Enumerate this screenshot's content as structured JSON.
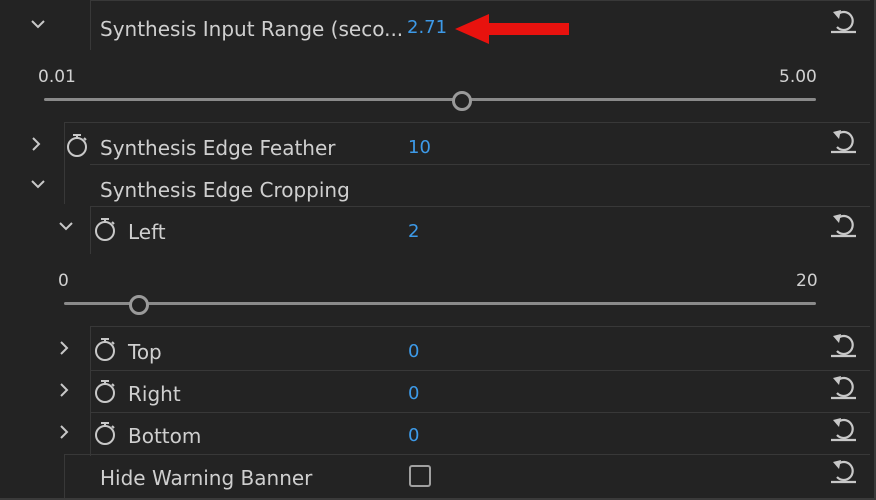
{
  "rows": {
    "input_range": {
      "label": "Synthesis Input Range (seco...",
      "value": "2.71",
      "min_label": "0.01",
      "max_label": "5.00",
      "slider_fraction": 0.541
    },
    "edge_feather": {
      "label": "Synthesis Edge Feather",
      "value": "10"
    },
    "edge_cropping": {
      "label": "Synthesis Edge Cropping"
    },
    "left": {
      "label": "Left",
      "value": "2",
      "min_label": "0",
      "max_label": "20",
      "slider_fraction": 0.1
    },
    "top": {
      "label": "Top",
      "value": "0"
    },
    "right": {
      "label": "Right",
      "value": "0"
    },
    "bottom": {
      "label": "Bottom",
      "value": "0"
    },
    "hide_warning": {
      "label": "Hide Warning Banner",
      "checked": false
    }
  },
  "icons": {
    "expand": "chevron-down-icon",
    "collapse": "chevron-right-icon",
    "stopwatch": "stopwatch-icon",
    "reset": "reset-icon",
    "annotation": "red-arrow-icon"
  },
  "colors": {
    "background": "#232323",
    "value_blue": "#3d9ae8",
    "arrow_red": "#e8120e"
  }
}
